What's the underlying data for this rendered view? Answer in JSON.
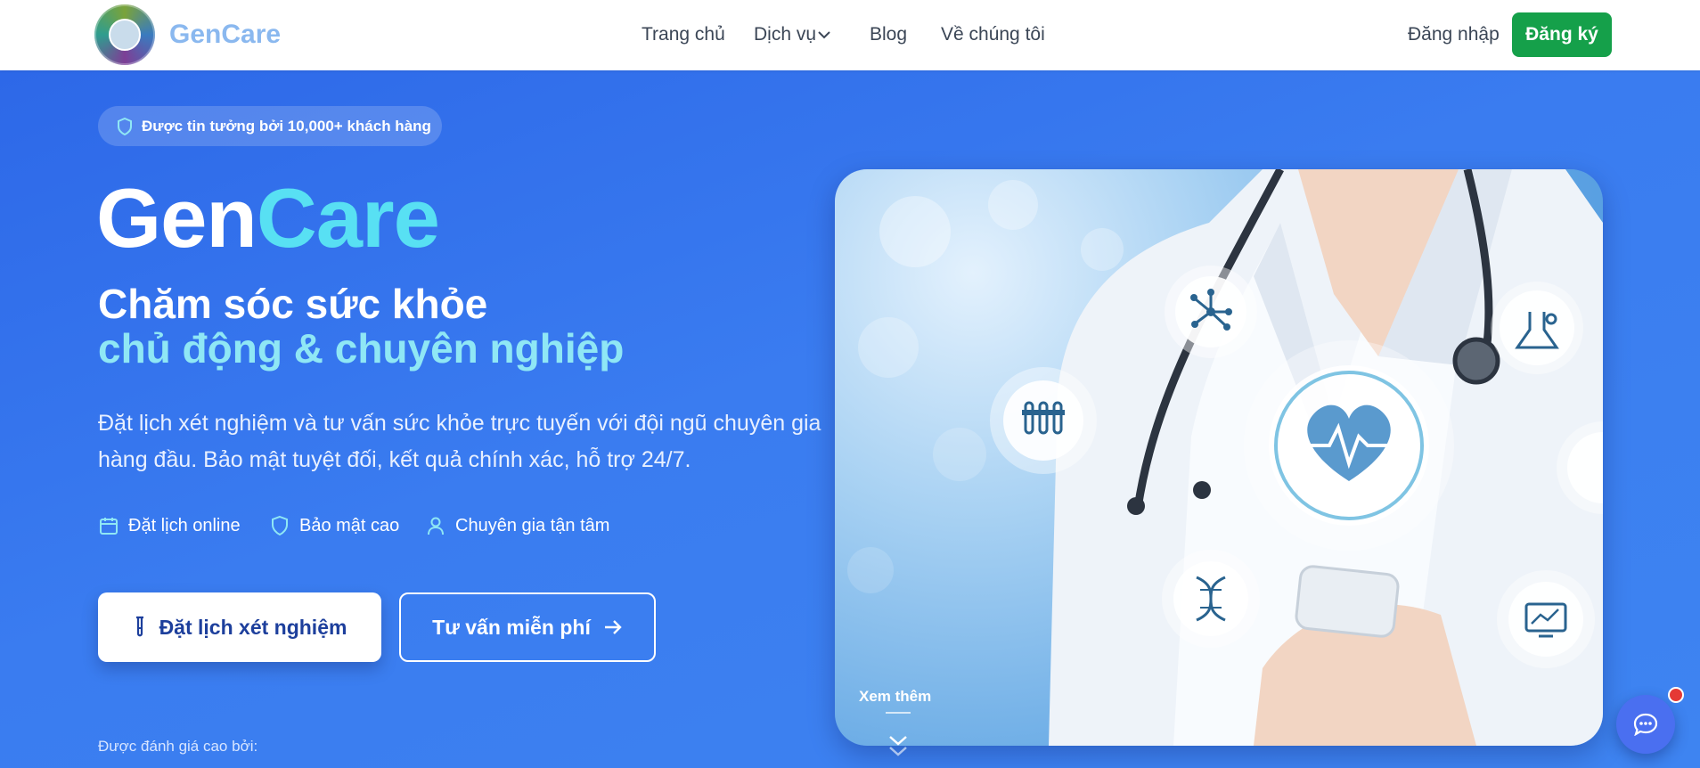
{
  "brand": {
    "name": "GenCare",
    "logo_icon": "gencare-logo-icon"
  },
  "nav": {
    "items": [
      {
        "label": "Trang chủ"
      },
      {
        "label": "Dịch vụ",
        "icon": "chevron-down-icon"
      },
      {
        "label": "Blog"
      },
      {
        "label": "Về chúng tôi"
      }
    ],
    "login_label": "Đăng nhập",
    "signup_label": "Đăng ký"
  },
  "hero": {
    "trust_badge": "Được tin tưởng bởi 10,000+ khách hàng",
    "title_part1": "Gen",
    "title_part2": "Care",
    "subtitle_line1": "Chăm sóc sức khỏe",
    "subtitle_line2": "chủ động & chuyên nghiệp",
    "description": "Đặt lịch xét nghiệm và tư vấn sức khỏe trực tuyến với đội ngũ chuyên gia hàng đầu. Bảo mật tuyệt đối, kết quả chính xác, hỗ trợ 24/7.",
    "features": [
      {
        "label": "Đặt lịch online",
        "icon": "calendar-icon"
      },
      {
        "label": "Bảo mật cao",
        "icon": "shield-icon"
      },
      {
        "label": "Chuyên gia tận tâm",
        "icon": "user-icon"
      }
    ],
    "primary_cta": "Đặt lịch xét nghiệm",
    "secondary_cta": "Tư vấn miễn phí",
    "rated_label": "Được đánh giá cao bởi:",
    "see_more": "Xem thêm"
  },
  "colors": {
    "brand_green": "#15a04a",
    "hero_blue": "#3a7cf0",
    "accent_cyan": "#58e0f3",
    "notification_red": "#e53935"
  }
}
